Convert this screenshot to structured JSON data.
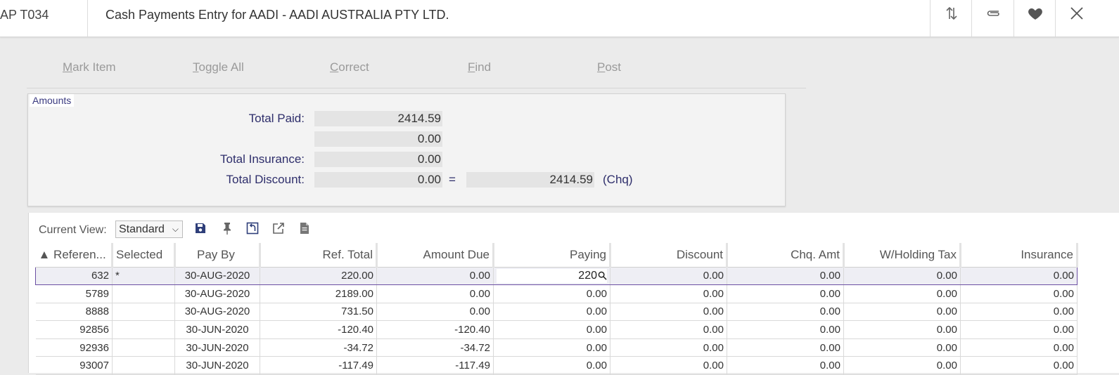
{
  "header": {
    "app_code": "AP T034",
    "title": "Cash Payments Entry for AADI - AADI AUSTRALIA PTY LTD.",
    "icons": [
      "sort-arrows-icon",
      "paperclip-icon",
      "heart-icon",
      "close-icon"
    ]
  },
  "toolbar": {
    "mark_item": {
      "first": "M",
      "rest": "ark Item"
    },
    "toggle_all": {
      "first": "T",
      "rest": "oggle All"
    },
    "correct": {
      "first": "C",
      "rest": "orrect"
    },
    "find": {
      "first": "F",
      "rest": "ind"
    },
    "post": {
      "first": "P",
      "rest": "ost"
    }
  },
  "amounts": {
    "legend": "Amounts",
    "total_paid_label": "Total Paid:",
    "total_paid": "2414.59",
    "unlabeled_value": "0.00",
    "total_insurance_label": "Total Insurance:",
    "total_insurance": "0.00",
    "total_discount_label": "Total Discount:",
    "total_discount": "0.00",
    "equals": "=",
    "net_total": "2414.59",
    "chq_label": "(Chq)"
  },
  "grid": {
    "current_view_label": "Current View:",
    "current_view_value": "Standard",
    "columns": [
      "▲ Referen...",
      "Selected",
      "Pay By",
      "Ref. Total",
      "Amount Due",
      "Paying",
      "Discount",
      "Chq. Amt",
      "W/Holding Tax",
      "Insurance"
    ],
    "rows": [
      [
        "632",
        "*",
        "30-AUG-2020",
        "220.00",
        "0.00",
        "220",
        "0.00",
        "0.00",
        "0.00",
        "0.00"
      ],
      [
        "5789",
        "",
        "30-AUG-2020",
        "2189.00",
        "0.00",
        "0.00",
        "0.00",
        "0.00",
        "0.00",
        "0.00"
      ],
      [
        "8888",
        "",
        "30-AUG-2020",
        "731.50",
        "0.00",
        "0.00",
        "0.00",
        "0.00",
        "0.00",
        "0.00"
      ],
      [
        "92856",
        "",
        "30-JUN-2020",
        "-120.40",
        "-120.40",
        "0.00",
        "0.00",
        "0.00",
        "0.00",
        "0.00"
      ],
      [
        "92936",
        "",
        "30-JUN-2020",
        "-34.72",
        "-34.72",
        "0.00",
        "0.00",
        "0.00",
        "0.00",
        "0.00"
      ],
      [
        "93007",
        "",
        "30-JUN-2020",
        "-117.49",
        "-117.49",
        "0.00",
        "0.00",
        "0.00",
        "0.00",
        "0.00"
      ]
    ]
  }
}
